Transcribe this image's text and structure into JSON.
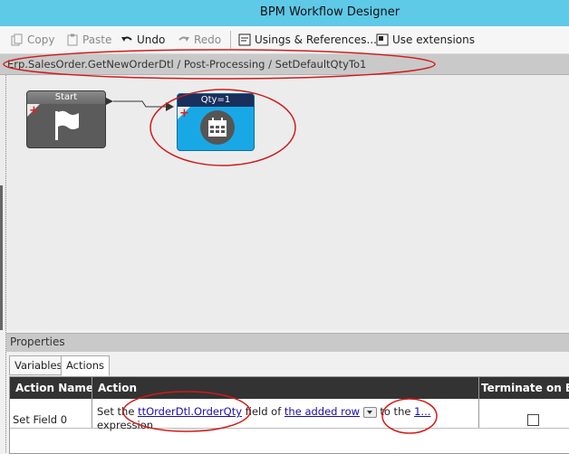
{
  "window": {
    "title": "BPM Workflow Designer"
  },
  "toolbar": {
    "copy_label": "Copy",
    "paste_label": "Paste",
    "undo_label": "Undo",
    "redo_label": "Redo",
    "usings_label": "Usings & References...",
    "extensions_label": "Use extensions"
  },
  "breadcrumb": {
    "path": "Erp.SalesOrder.GetNewOrderDtl / Post-Processing / SetDefaultQtyTo1"
  },
  "canvas": {
    "start_node": {
      "label": "Start",
      "icon": "flag-icon"
    },
    "action_node": {
      "label": "Qty=1",
      "icon": "calendar-icon"
    }
  },
  "properties": {
    "header": "Properties",
    "tabs": [
      {
        "label": "Variables"
      },
      {
        "label": "Actions"
      }
    ],
    "active_tab": "Actions",
    "table": {
      "columns": [
        "Action Name",
        "Action",
        "Terminate on Err"
      ],
      "rows": [
        {
          "name": "Set Field 0",
          "action": {
            "prefix": "Set the ",
            "field_link": "ttOrderDtl.OrderQty",
            "mid": " field of ",
            "row_link": "the added row",
            "to": " to the ",
            "expr_link": "1...",
            "suffix": "expression"
          },
          "terminate": false
        }
      ]
    }
  },
  "colors": {
    "titlebar": "#5fc9e8",
    "action_node": "#19a8e6",
    "annotation": "#d11a1a"
  }
}
